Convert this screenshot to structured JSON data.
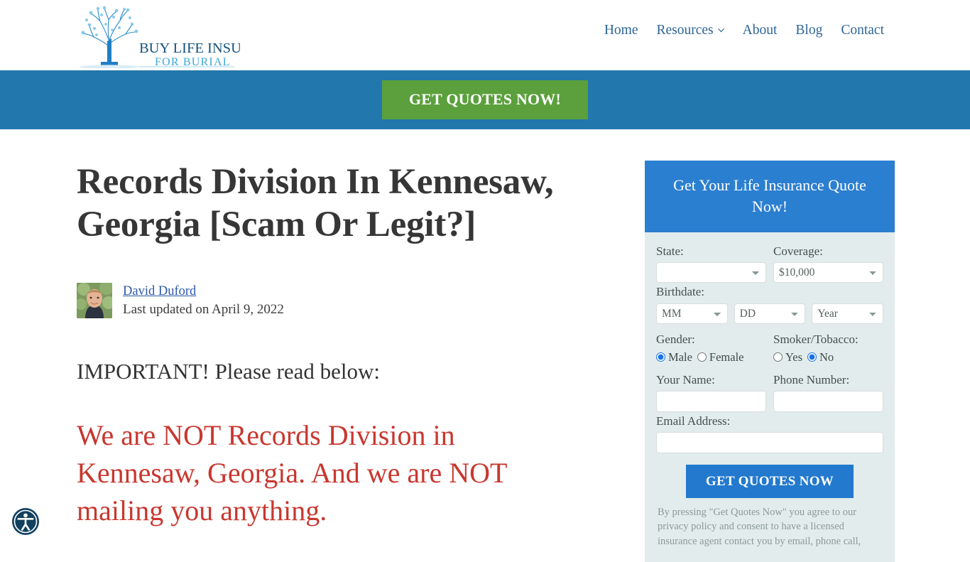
{
  "header": {
    "logo": {
      "line1": "BUY LIFE INSURANCE",
      "line2": "FOR BURIAL",
      "icon": "tree-icon"
    },
    "nav": [
      {
        "label": "Home",
        "has_caret": false
      },
      {
        "label": "Resources",
        "has_caret": true
      },
      {
        "label": "About",
        "has_caret": false
      },
      {
        "label": "Blog",
        "has_caret": false
      },
      {
        "label": "Contact",
        "has_caret": false
      }
    ]
  },
  "cta_banner": {
    "button_label": "GET QUOTES NOW!",
    "banner_color": "#2277ac",
    "button_color": "#5ba03c"
  },
  "article": {
    "title": "Records Division In Kennesaw, Georgia [Scam Or Legit?]",
    "author": "David Duford",
    "updated": "Last updated on April 9, 2022",
    "lead_heading": "IMPORTANT! Please read below:",
    "alert_heading": "We are NOT Records Division in Kennesaw, Georgia. And we are NOT mailing you anything.",
    "alert_color": "#c8372f"
  },
  "sidebar": {
    "header_title": "Get Your Life Insurance Quote Now!",
    "header_color": "#2b7fd0",
    "body_color": "#e2ecec",
    "fields": {
      "state_label": "State:",
      "state_value": "",
      "coverage_label": "Coverage:",
      "coverage_value": "$10,000",
      "birthdate_label": "Birthdate:",
      "birth_month": "MM",
      "birth_day": "DD",
      "birth_year": "Year",
      "gender_label": "Gender:",
      "gender_male": "Male",
      "gender_female": "Female",
      "gender_selected": "Male",
      "smoker_label": "Smoker/Tobacco:",
      "smoker_yes": "Yes",
      "smoker_no": "No",
      "smoker_selected": "No",
      "name_label": "Your Name:",
      "name_value": "",
      "phone_label": "Phone Number:",
      "phone_value": "",
      "email_label": "Email Address:",
      "email_value": ""
    },
    "submit_label": "GET QUOTES NOW",
    "disclaimer": "By pressing \"Get Quotes Now\" you agree to our privacy policy and consent to have a licensed insurance agent contact you by email, phone call,"
  },
  "accessibility": {
    "button_name": "accessibility-icon"
  }
}
